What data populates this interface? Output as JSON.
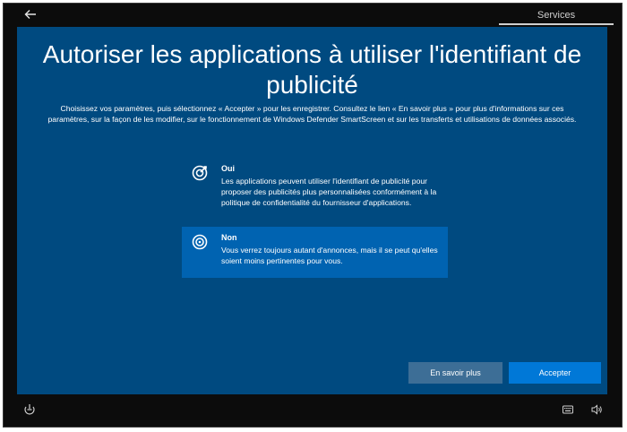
{
  "topbar": {
    "back_icon": "arrow-left-icon",
    "tab_label": "Services"
  },
  "main": {
    "title": "Autoriser les applications à utiliser l'identifiant de publicité",
    "description": "Choisissez vos paramètres, puis sélectionnez « Accepter » pour les enregistrer. Consultez le lien « En savoir plus » pour plus d'informations sur ces paramètres, sur la façon de les modifier, sur le fonctionnement de Windows Defender SmartScreen et sur les transferts et utilisations de données associés.",
    "options": [
      {
        "icon": "target-check-icon",
        "title": "Oui",
        "body": "Les applications peuvent utiliser l'identifiant de publicité pour proposer des publicités plus personnalisées conformément à la politique de confidentialité du fournisseur d'applications.",
        "selected": false
      },
      {
        "icon": "target-icon",
        "title": "Non",
        "body": "Vous verrez toujours autant d'annonces, mais il se peut qu'elles soient moins pertinentes pour vous.",
        "selected": true
      }
    ],
    "buttons": {
      "learn_more": "En savoir plus",
      "accept": "Accepter"
    }
  },
  "bottombar": {
    "left_icon": "ease-of-access-icon",
    "right_icons": [
      "keyboard-icon",
      "volume-icon"
    ]
  },
  "colors": {
    "panel_bg": "#004a80",
    "selected_option_bg": "#0063b1",
    "accept_button_bg": "#0078d7",
    "learn_more_button_bg": "#3d6e96",
    "frame_bg": "#0c0c0c"
  }
}
